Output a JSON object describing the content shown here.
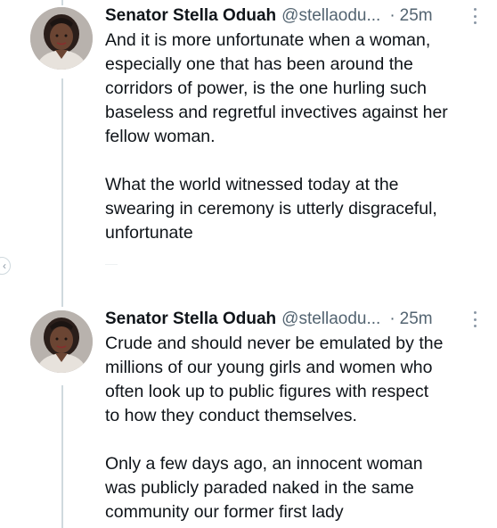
{
  "thread": {
    "tweets": [
      {
        "author": {
          "name": "Senator Stella Oduah",
          "handle": "@stellaodu...",
          "avatar_icon": "profile-photo-avatar"
        },
        "separator": "·",
        "timestamp": "25m",
        "paragraphs": [
          "And it is more unfortunate when a woman,\nespecially one that has been around the\ncorridors of power, is the one hurling such\nbaseless and regretful invectives against her\nfellow woman.",
          "What the world witnessed today at the\nswearing in ceremony is utterly disgraceful,\nunfortunate"
        ]
      },
      {
        "author": {
          "name": "Senator Stella Oduah",
          "handle": "@stellaodu...",
          "avatar_icon": "profile-photo-avatar"
        },
        "separator": "·",
        "timestamp": "25m",
        "paragraphs": [
          "Crude and should never be emulated by the\nmillions of our young girls and women who\noften look up to public figures with respect\nto how they conduct themselves.",
          "Only a few days ago, an innocent woman\nwas publicly paraded naked in the same\ncommunity our former first lady"
        ]
      }
    ]
  },
  "colors": {
    "text_primary": "#0f1419",
    "text_secondary": "#536471",
    "thread_line": "#cfd9de",
    "background": "#ffffff"
  },
  "icons": {
    "more": "more-options-icon",
    "nav_back": "chevron-left-icon"
  }
}
